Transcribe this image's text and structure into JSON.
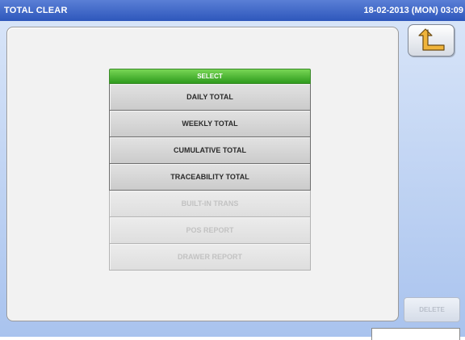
{
  "header": {
    "title": "TOTAL CLEAR",
    "datetime": "18-02-2013 (MON) 03:09"
  },
  "menu": {
    "header_label": "SELECT",
    "items": [
      {
        "label": "DAILY TOTAL",
        "enabled": true
      },
      {
        "label": "WEEKLY TOTAL",
        "enabled": true
      },
      {
        "label": "CUMULATIVE TOTAL",
        "enabled": true
      },
      {
        "label": "TRACEABILITY TOTAL",
        "enabled": true
      },
      {
        "label": "BUILT-IN TRANS",
        "enabled": false
      },
      {
        "label": "POS REPORT",
        "enabled": false
      },
      {
        "label": "DRAWER REPORT",
        "enabled": false
      }
    ]
  },
  "actions": {
    "delete_label": "DELETE",
    "back_icon": "return-arrow-icon"
  },
  "colors": {
    "titlebar": "#2e57bb",
    "select_header": "#3aa826",
    "background": "#b9d0f2",
    "back_arrow": "#e8a21a"
  }
}
